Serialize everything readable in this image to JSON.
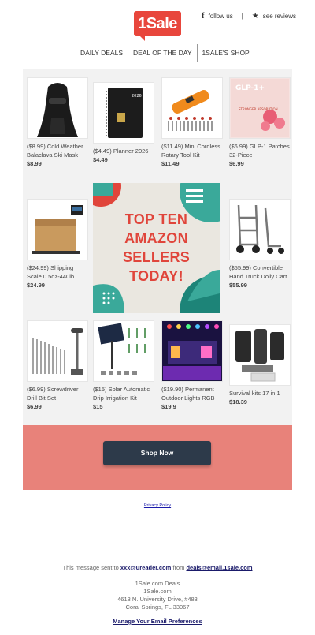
{
  "header": {
    "logo_text": "1Sale",
    "follow_label": "follow us",
    "separator": "|",
    "reviews_label": "see reviews",
    "fb_icon": "f",
    "star_icon": "★"
  },
  "nav": {
    "items": [
      "DAILY DEALS",
      "DEAL OF THE DAY",
      "1SALE'S SHOP"
    ]
  },
  "products": [
    {
      "name": "($8.99) Cold Weather Balaclava Ski Mask",
      "price": "$8.99"
    },
    {
      "name": "($4.49) Planner 2026",
      "price": "$4.49"
    },
    {
      "name": "($11.49) Mini Cordless Rotary Tool Kit",
      "price": "$11.49"
    },
    {
      "name": "($6.99) GLP-1 Patches 32-Piece",
      "price": "$6.99"
    },
    {
      "name": "($24.99) Shipping Scale 0.5oz-440lb",
      "price": "$24.99"
    },
    {
      "name": "($55.99) Convertible Hand Truck Dolly Cart",
      "price": "$55.99"
    },
    {
      "name": "($6.99) Screwdriver Drill Bit Set",
      "price": "$6.99"
    },
    {
      "name": "($15) Solar Automatic Drip Irrigation Kit",
      "price": "$15"
    },
    {
      "name": "($19.90) Permanent Outdoor Lights RGB",
      "price": "$19.9"
    },
    {
      "name": "Survival kits 17 in 1",
      "price": "$18.39"
    }
  ],
  "banner": {
    "line1": "TOP TEN",
    "line2": "AMAZON",
    "line3": "SELLERS",
    "line4": "TODAY!"
  },
  "planner_text": "2026",
  "patch_text": {
    "title": "GLP-1+",
    "sub": "STRONGER ABSORPTION"
  },
  "cta": {
    "label": "Shop Now"
  },
  "privacy_label": "Privacy Policy",
  "footer": {
    "sent_prefix": "This message sent to ",
    "email": "xxx@ureader.com",
    "from_text": " from ",
    "from_email": "deals@email.1sale.com",
    "company": "1Sale.com Deals",
    "site": "1Sale.com",
    "address1": "4613 N. University Drive, #483",
    "address2": "Coral Springs, FL 33067",
    "manage_label": "Manage Your Email Preferences"
  },
  "colors": {
    "brand": "#e8463c",
    "cta_bg": "#2d3a4a",
    "band": "#e8827a",
    "banner_teal": "#3aa99a"
  }
}
